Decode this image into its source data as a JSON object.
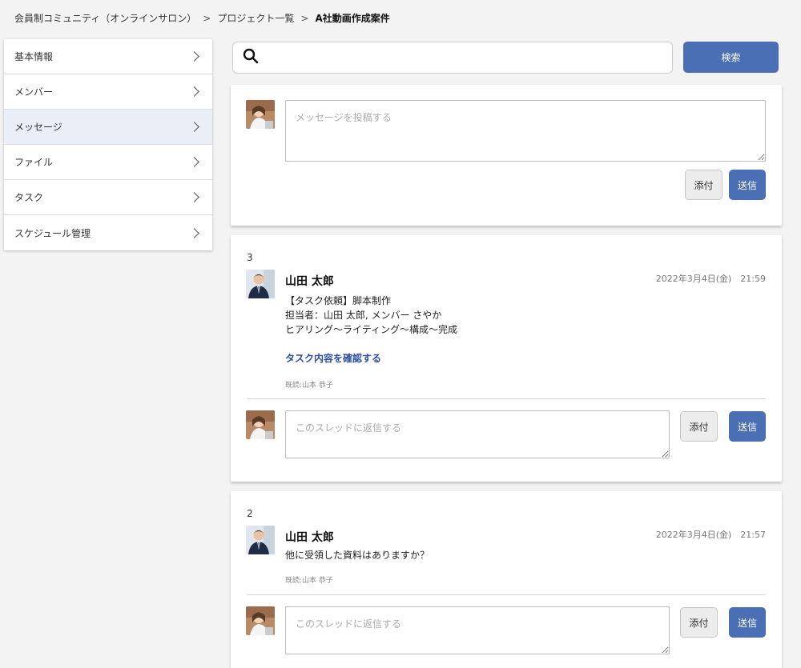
{
  "breadcrumb": {
    "items": [
      "会員制コミュニティ（オンラインサロン）",
      "プロジェクト一覧",
      "A社動画作成案件"
    ],
    "separator": ">"
  },
  "sidebar": {
    "items": [
      {
        "label": "基本情報"
      },
      {
        "label": "メンバー"
      },
      {
        "label": "メッセージ",
        "active": true
      },
      {
        "label": "ファイル"
      },
      {
        "label": "タスク"
      },
      {
        "label": "スケジュール管理"
      }
    ]
  },
  "search": {
    "value": "",
    "placeholder": "",
    "button_label": "検索"
  },
  "composer": {
    "placeholder": "メッセージを投稿する",
    "attach_label": "添付",
    "send_label": "送信"
  },
  "messages": [
    {
      "number": "3",
      "author": "山田 太郎",
      "timestamp": "2022年3月4日(金)　21:59",
      "lines": [
        "【タスク依頼】脚本制作",
        "担当者：山田 太郎, メンバー さやか",
        "ヒアリング〜ライティング〜構成〜完成"
      ],
      "link": "タスク内容を確認する",
      "read_by": "既読:山本 恭子",
      "reply_placeholder": "このスレッドに返信する",
      "attach_label": "添付",
      "send_label": "送信"
    },
    {
      "number": "2",
      "author": "山田 太郎",
      "timestamp": "2022年3月4日(金)　21:57",
      "lines": [
        "他に受領した資料はありますか？"
      ],
      "read_by": "既読:山本 恭子",
      "reply_placeholder": "このスレッドに返信する",
      "attach_label": "添付",
      "send_label": "送信"
    }
  ],
  "colors": {
    "accent": "#4a6fb4",
    "link": "#2b4ea1",
    "background": "#f3f3f3",
    "active_nav": "#e9eef7"
  }
}
